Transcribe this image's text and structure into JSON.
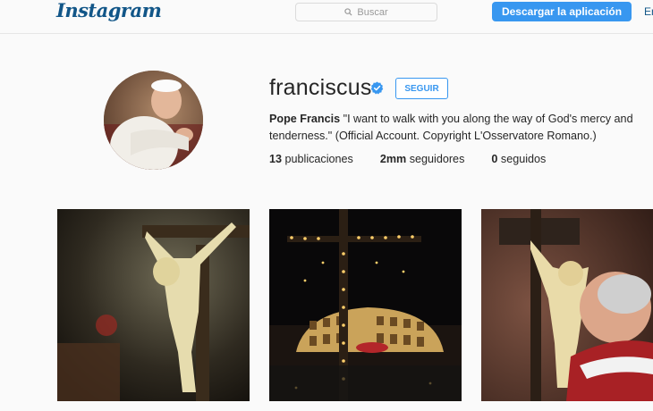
{
  "header": {
    "logo": "Instagram",
    "search_placeholder": "Buscar",
    "download_label": "Descargar la aplicación",
    "login_label": "Entrar"
  },
  "profile": {
    "username": "franciscus",
    "follow_label": "SEGUIR",
    "bio_name": "Pope Francis",
    "bio_text": " \"I want to walk with you along the way of God's mercy and tenderness.\" (Official Account. Copyright L'Osservatore Romano.)",
    "posts_count": "13",
    "posts_label": "publicaciones",
    "followers_count": "2mm",
    "followers_label": "seguidores",
    "following_count": "0",
    "following_label": "seguidos"
  },
  "icons": {
    "search": "search-icon",
    "verified": "verified-badge-icon"
  },
  "colors": {
    "brand_blue": "#3897f0",
    "logo_color": "#125688"
  }
}
